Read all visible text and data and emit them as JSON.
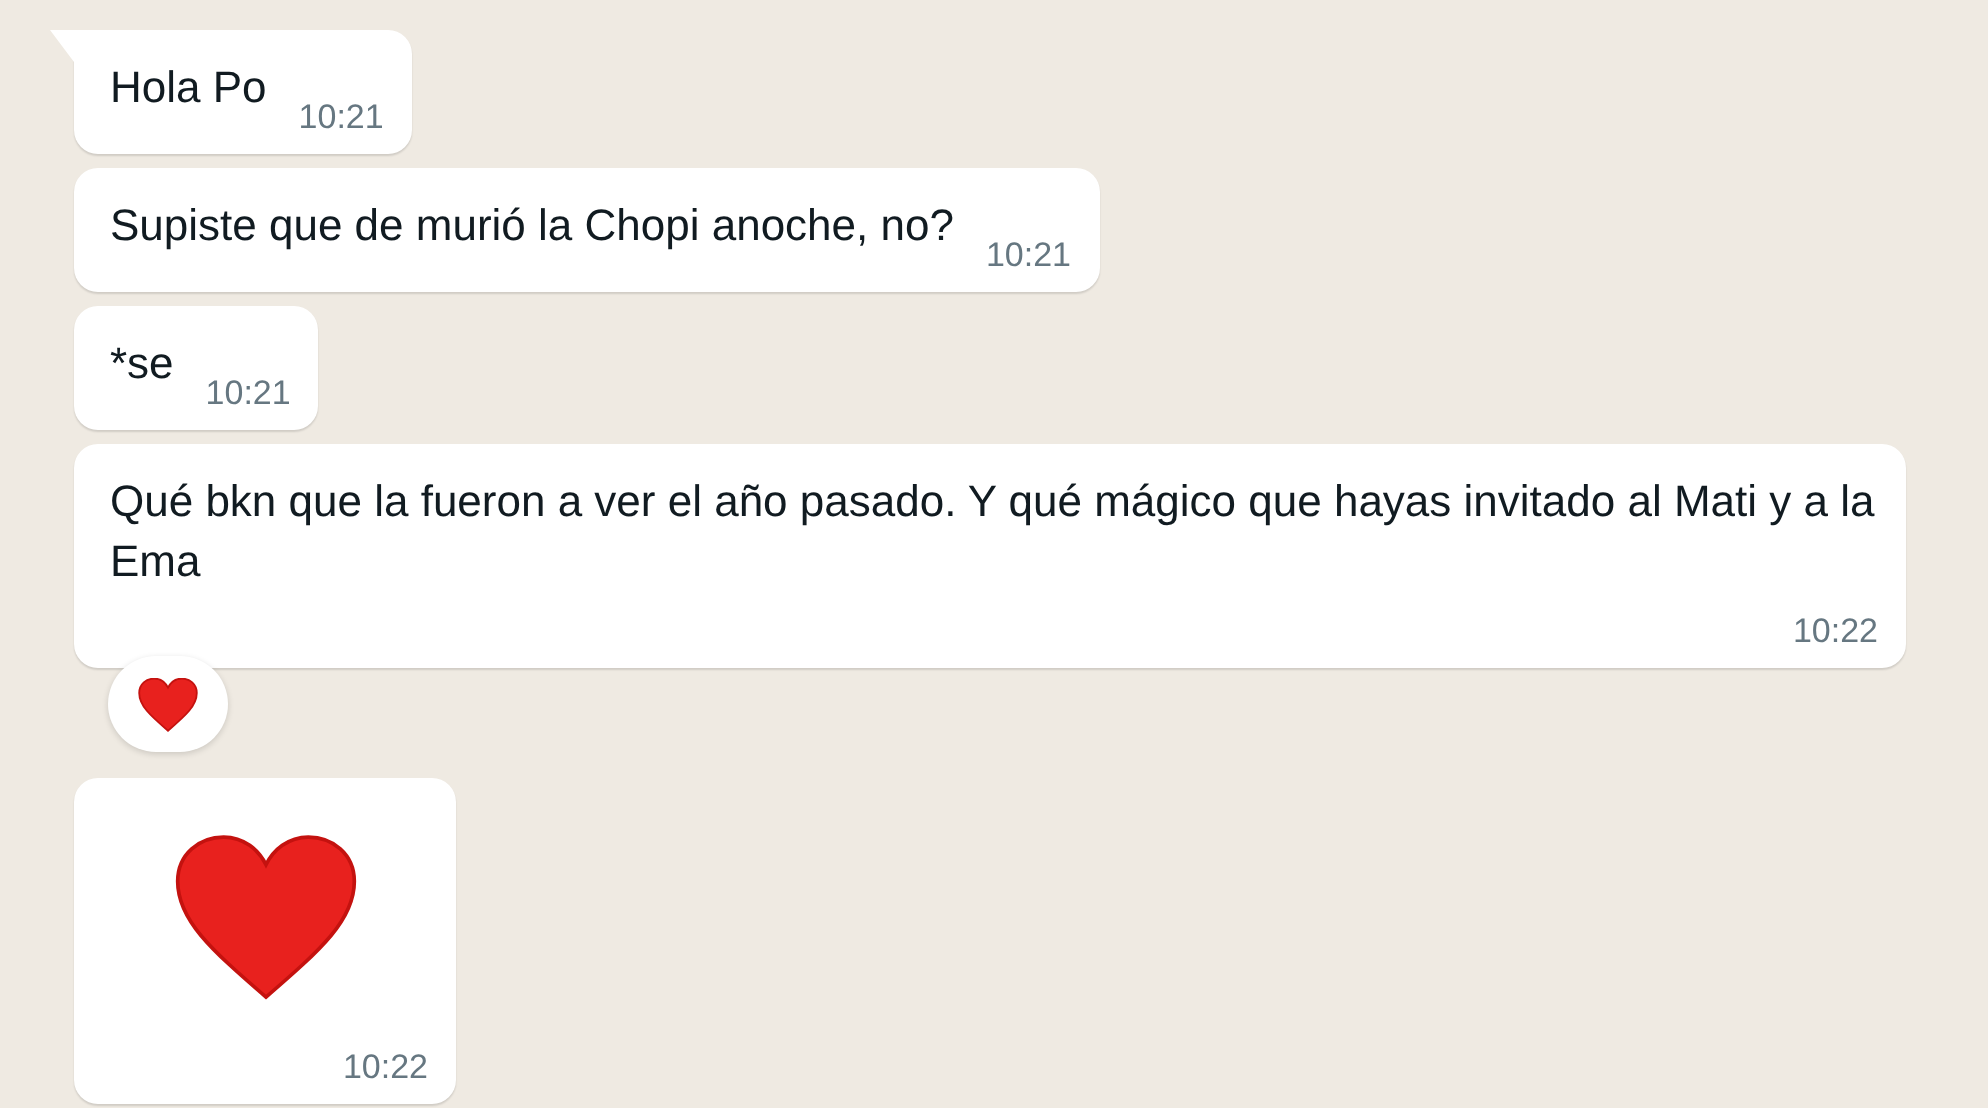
{
  "messages": [
    {
      "kind": "text",
      "text": "Hola Po",
      "time": "10:21",
      "tail": true,
      "reaction": false
    },
    {
      "kind": "text",
      "text": "Supiste que de murió la Chopi anoche, no?",
      "time": "10:21",
      "tail": false,
      "reaction": false
    },
    {
      "kind": "text",
      "text": "*se",
      "time": "10:21",
      "tail": false,
      "reaction": false
    },
    {
      "kind": "text",
      "text": "Qué bkn que la fueron a ver el año pasado. Y qué mágico que hayas invitado al Mati y a la Ema",
      "time": "10:22",
      "tail": false,
      "reaction": true
    },
    {
      "kind": "emoji",
      "time": "10:22",
      "tail": false,
      "reaction": false
    }
  ]
}
